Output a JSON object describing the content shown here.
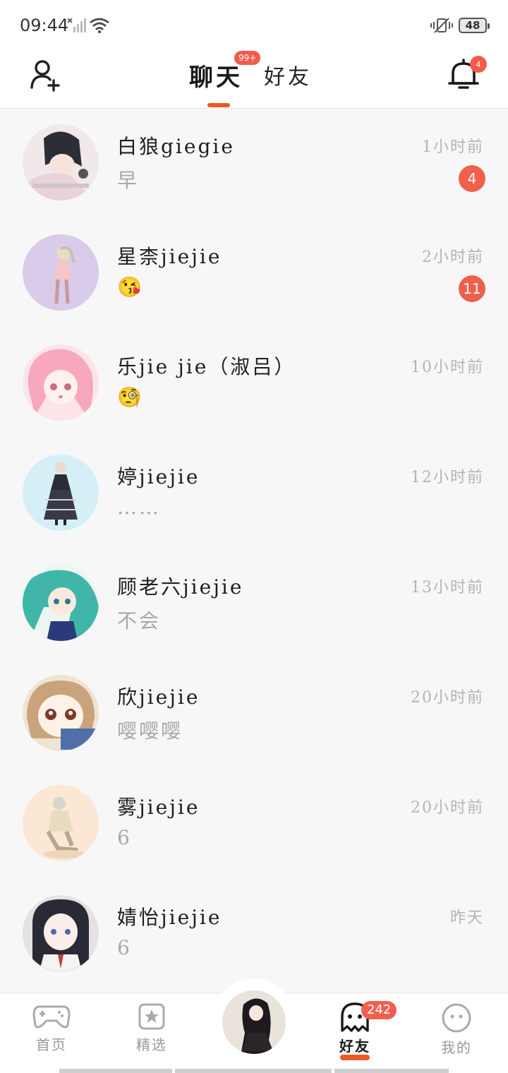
{
  "status_bar": {
    "time": "09:44",
    "battery": "48"
  },
  "header": {
    "tab_chat": "聊天",
    "tab_chat_badge": "99+",
    "tab_friends": "好友",
    "bell_badge": "4"
  },
  "chats": [
    {
      "name": "白狼giegie",
      "message": "早",
      "time": "1小时前",
      "unread": "4"
    },
    {
      "name": "星柰jiejie",
      "message": "😘",
      "time": "2小时前",
      "unread": "11"
    },
    {
      "name": "乐jie jie（淑吕）",
      "message": "🧐",
      "time": "10小时前",
      "unread": ""
    },
    {
      "name": "婷jiejie",
      "message": "……",
      "time": "12小时前",
      "unread": ""
    },
    {
      "name": "顾老六jiejie",
      "message": "不会",
      "time": "13小时前",
      "unread": ""
    },
    {
      "name": "欣jiejie",
      "message": "嘤嘤嘤",
      "time": "20小时前",
      "unread": ""
    },
    {
      "name": "雾jiejie",
      "message": "6",
      "time": "20小时前",
      "unread": ""
    },
    {
      "name": "婧怡jiejie",
      "message": "6",
      "time": "昨天",
      "unread": ""
    }
  ],
  "bottom_nav": {
    "home": "首页",
    "featured": "精选",
    "friends": "好友",
    "friends_badge": "242",
    "mine": "我的"
  },
  "colors": {
    "accent": "#ea5a28",
    "badge": "#f0604e"
  }
}
